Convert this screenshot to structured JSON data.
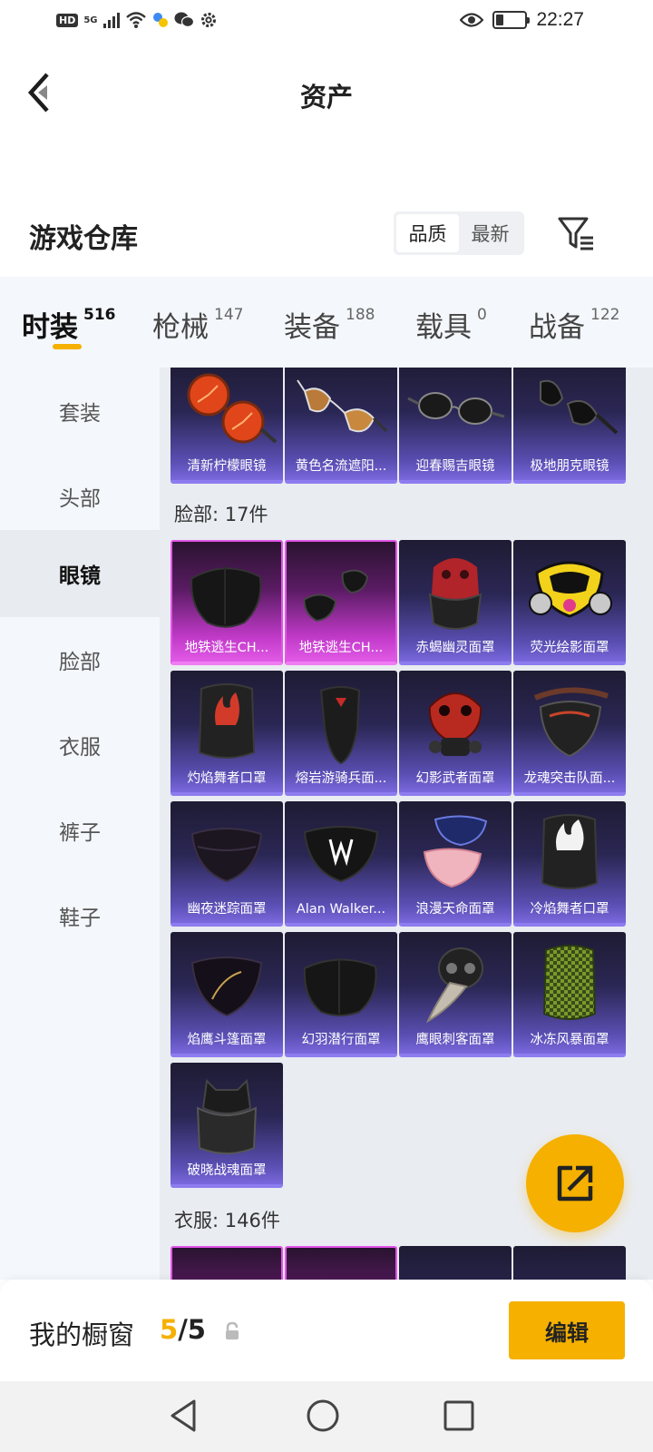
{
  "status_bar": {
    "hd": "HD",
    "network": "5G",
    "time": "22:27"
  },
  "header": {
    "title": "资产"
  },
  "warehouse": {
    "title": "游戏仓库",
    "sort_options": [
      "品质",
      "最新"
    ],
    "active_sort": "品质"
  },
  "tabs": [
    {
      "label": "时装",
      "count": "516",
      "active": true
    },
    {
      "label": "枪械",
      "count": "147",
      "active": false
    },
    {
      "label": "装备",
      "count": "188",
      "active": false
    },
    {
      "label": "载具",
      "count": "0",
      "active": false
    },
    {
      "label": "战备",
      "count": "122",
      "active": false
    }
  ],
  "sidebar": {
    "items": [
      "套装",
      "头部",
      "眼镜",
      "脸部",
      "衣服",
      "裤子",
      "鞋子"
    ],
    "active": "眼镜"
  },
  "glasses_items": [
    {
      "name": "清新柠檬眼镜",
      "icon": "orange-round-sunglasses"
    },
    {
      "name": "黄色名流遮阳...",
      "icon": "aviator-sunglasses"
    },
    {
      "name": "迎春赐吉眼镜",
      "icon": "round-dark-glasses"
    },
    {
      "name": "极地朋克眼镜",
      "icon": "dark-sport-glasses"
    }
  ],
  "face_section": {
    "title": "脸部: 17件",
    "items": [
      {
        "name": "地铁逃生CH...",
        "rarity": "legendary",
        "icon": "black-face-mask"
      },
      {
        "name": "地铁逃生CH...",
        "rarity": "legendary",
        "icon": "black-mask-pieces"
      },
      {
        "name": "赤蝎幽灵面罩",
        "rarity": "epic",
        "icon": "red-skull-balaclava"
      },
      {
        "name": "荧光绘影面罩",
        "rarity": "epic",
        "icon": "neon-gas-mask"
      },
      {
        "name": "灼焰舞者口罩",
        "rarity": "epic",
        "icon": "flame-neck-gaiter"
      },
      {
        "name": "熔岩游骑兵面...",
        "rarity": "epic",
        "icon": "bandana-mask"
      },
      {
        "name": "幻影武者面罩",
        "rarity": "epic",
        "icon": "red-samurai-mask"
      },
      {
        "name": "龙魂突击队面...",
        "rarity": "epic",
        "icon": "tactical-half-mask"
      },
      {
        "name": "幽夜迷踪面罩",
        "rarity": "epic",
        "icon": "dark-cloth-mask"
      },
      {
        "name": "Alan Walker...",
        "rarity": "epic",
        "icon": "aw-logo-mask"
      },
      {
        "name": "浪漫天命面罩",
        "rarity": "epic",
        "icon": "pink-blue-masks"
      },
      {
        "name": "冷焰舞者口罩",
        "rarity": "epic",
        "icon": "white-flame-gaiter"
      },
      {
        "name": "焰鹰斗篷面罩",
        "rarity": "epic",
        "icon": "gold-line-mask"
      },
      {
        "name": "幻羽潜行面罩",
        "rarity": "epic",
        "icon": "black-face-mask"
      },
      {
        "name": "鹰眼刺客面罩",
        "rarity": "epic",
        "icon": "plague-doctor-mask"
      },
      {
        "name": "冰冻风暴面罩",
        "rarity": "epic",
        "icon": "green-check-gaiter"
      },
      {
        "name": "破晓战魂面罩",
        "rarity": "epic",
        "icon": "armored-neck-guard"
      }
    ]
  },
  "clothes_section": {
    "title": "衣服: 146件"
  },
  "bottom_bar": {
    "label": "我的橱窗",
    "count_current": "5",
    "count_total": "/5",
    "edit_label": "编辑"
  },
  "colors": {
    "accent": "#f5b000",
    "epic_card": "#5a4fb3",
    "legendary_card": "#c13ac9"
  }
}
